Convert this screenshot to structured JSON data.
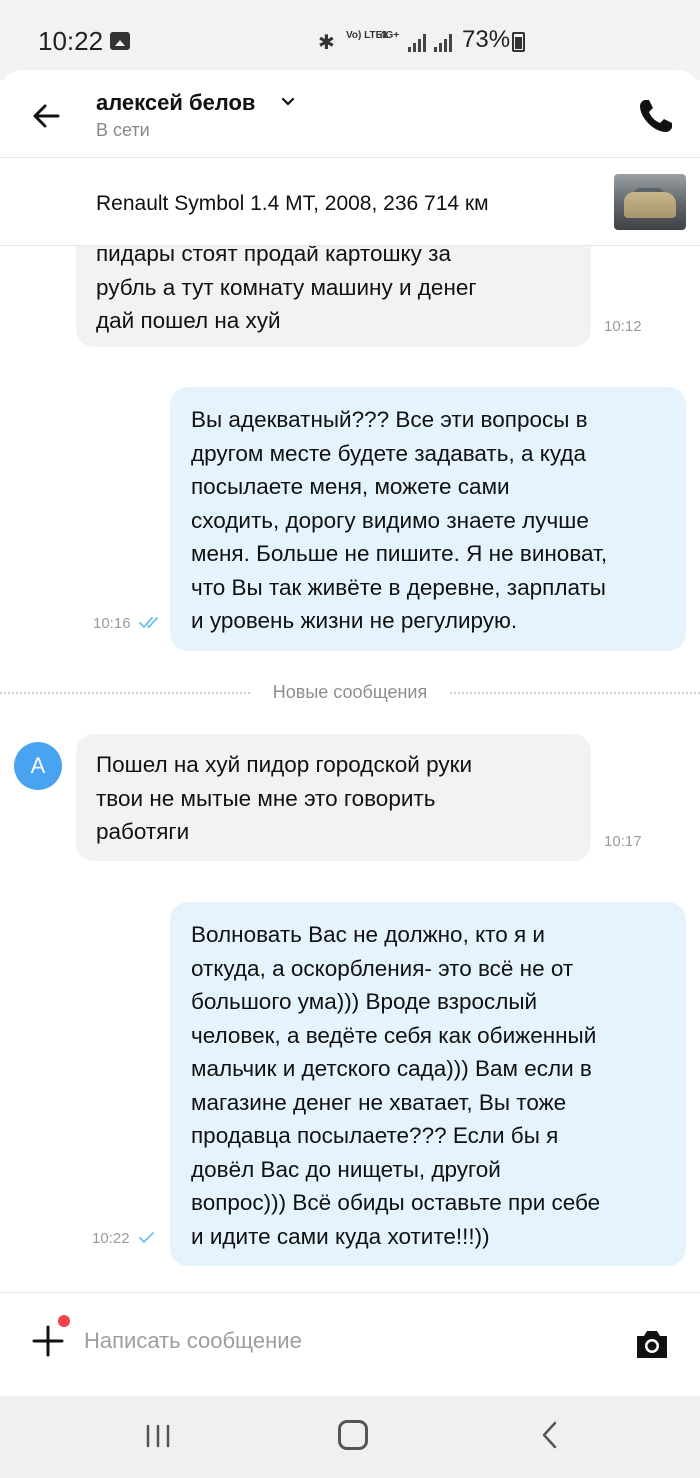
{
  "status_bar": {
    "time": "10:22",
    "net_lte": "Vo) LTE1",
    "net_4g": "4G+",
    "battery": "73%"
  },
  "header": {
    "contact_name": "алексей белов",
    "presence": "В сети",
    "back_icon": "arrow-left-icon",
    "call_icon": "phone-icon"
  },
  "listing": {
    "title": "Renault Symbol 1.4 MT, 2008, 236 714 км"
  },
  "messages": [
    {
      "direction": "incoming",
      "text": "пидары стоят продай картошку за\nрубль а тут комнату машину и денег\nдай пошел на хуй",
      "time": "10:12"
    },
    {
      "direction": "outgoing",
      "text": "Вы адекватный??? Все эти вопросы в\nдругом месте будете задавать,  а куда\nпосылаете меня,  можете сами\nсходить,  дорогу видимо знаете лучше\nменя. Больше не пишите. Я не виноват,\nчто Вы так живёте в деревне,  зарплаты\nи уровень жизни не регулирую.",
      "time": "10:16",
      "status": "read"
    },
    {
      "direction": "incoming",
      "avatar_letter": "А",
      "text": "Пошел на хуй пидор городской руки\nтвои не мытые мне это говорить\nработяги",
      "time": "10:17"
    },
    {
      "direction": "outgoing",
      "text": "Волновать Вас не должно,  кто я и\nоткуда,  а оскорбления- это всё не от\nбольшого ума))) Вроде взрослый\nчеловек,  а ведёте себя как обиженный\nмальчик и детского сада))) Вам если в\nмагазине денег не хватает,  Вы тоже\nпродавца посылаете??? Если бы я\nдовёл Вас до нищеты,  другой\nвопрос))) Всё обиды оставьте при себе\nи идите сами куда хотите!!!))",
      "time": "10:22",
      "status": "sent"
    }
  ],
  "divider": {
    "label": "Новые сообщения"
  },
  "composer": {
    "placeholder": "Написать сообщение",
    "value": "",
    "attach_icon": "plus-icon",
    "camera_icon": "camera-icon"
  },
  "colors": {
    "accent": "#4aa3f0",
    "incoming_bubble": "#f2f2f2",
    "outgoing_bubble": "#e4f3fc",
    "notification_dot": "#f2434a"
  }
}
